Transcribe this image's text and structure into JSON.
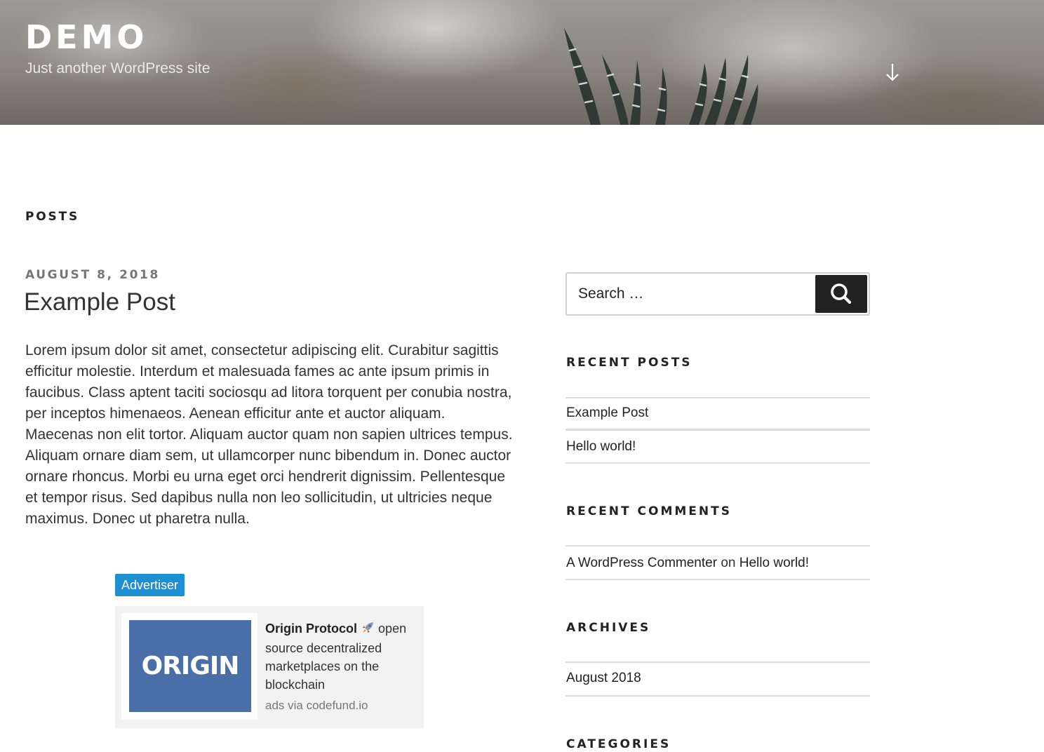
{
  "header": {
    "site_title": "DEMO",
    "site_description": "Just another WordPress site",
    "scroll_icon": "arrow-down-icon"
  },
  "main": {
    "page_title": "POSTS",
    "post": {
      "date": "AUGUST 8, 2018",
      "title": "Example Post",
      "body": "Lorem ipsum dolor sit amet, consectetur adipiscing elit. Curabitur sagittis efficitur molestie. Interdum et malesuada fames ac ante ipsum primis in faucibus. Class aptent taciti sociosqu ad litora torquent per conubia nostra, per inceptos himenaeos. Aenean efficitur ante et auctor aliquam. Maecenas non elit tortor. Aliquam auctor quam non sapien ultrices tempus. Aliquam ornare diam sem, ut ullamcorper nunc bibendum in. Donec auctor ornare rhoncus. Morbi eu urna eget orci hendrerit dignissim. Pellentesque et tempor risus. Sed dapibus nulla non leo sollicitudin, ut ultricies neque maximus. Donec ut pharetra nulla."
    },
    "ad": {
      "badge": "Advertiser",
      "image_text": "ORIGIN",
      "brand": "Origin Protocol",
      "emoji": "rocket-icon",
      "description": "open source decentralized marketplaces on the blockchain",
      "via": "ads via codefund.io",
      "brand_color": "#4a6ea8",
      "badge_color": "#1e8fd2"
    }
  },
  "sidebar": {
    "search": {
      "placeholder": "Search …",
      "button_icon": "search-icon"
    },
    "recent_posts": {
      "title": "RECENT POSTS",
      "items": [
        "Example Post",
        "Hello world!"
      ]
    },
    "recent_comments": {
      "title": "RECENT COMMENTS",
      "author": "A WordPress Commenter",
      "on": "on",
      "post": "Hello world!"
    },
    "archives": {
      "title": "ARCHIVES",
      "items": [
        "August 2018"
      ]
    },
    "categories": {
      "title": "CATEGORIES"
    }
  }
}
